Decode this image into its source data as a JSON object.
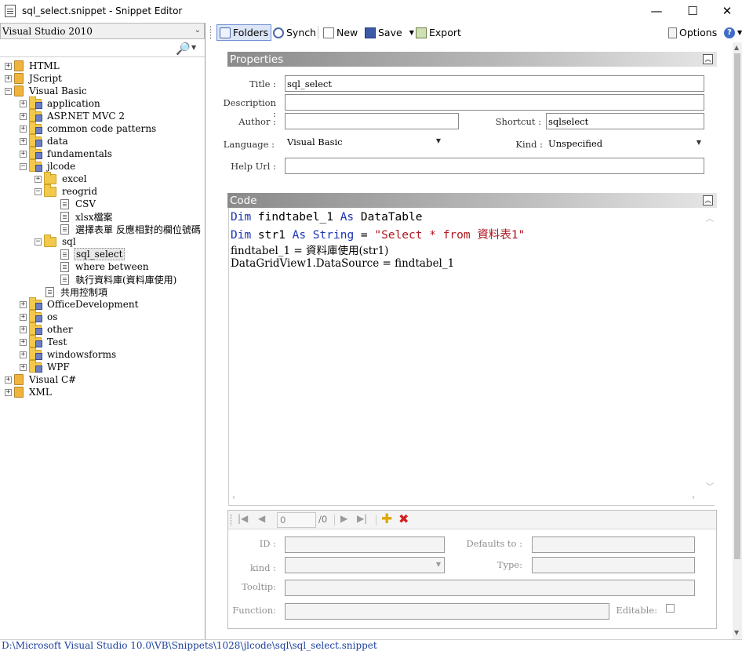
{
  "window": {
    "title": "sql_select.snippet - Snippet Editor",
    "minimize": "—",
    "maximize": "☐",
    "close": "✕"
  },
  "sidebar": {
    "language_select": "Visual Studio 2010",
    "tree": [
      {
        "label": "HTML",
        "level": 0,
        "expander": "+",
        "icon": "root-folder-icon"
      },
      {
        "label": "JScript",
        "level": 0,
        "expander": "+",
        "icon": "root-folder-icon"
      },
      {
        "label": "Visual Basic",
        "level": 0,
        "expander": "−",
        "icon": "root-folder-icon"
      },
      {
        "label": "application",
        "level": 1,
        "expander": "+",
        "icon": "category-folder-icon"
      },
      {
        "label": "ASP.NET MVC 2",
        "level": 1,
        "expander": "+",
        "icon": "category-folder-icon"
      },
      {
        "label": "common code patterns",
        "level": 1,
        "expander": "+",
        "icon": "category-folder-icon"
      },
      {
        "label": "data",
        "level": 1,
        "expander": "+",
        "icon": "category-folder-icon"
      },
      {
        "label": "fundamentals",
        "level": 1,
        "expander": "+",
        "icon": "category-folder-icon"
      },
      {
        "label": "jlcode",
        "level": 1,
        "expander": "−",
        "icon": "category-folder-icon"
      },
      {
        "label": "excel",
        "level": 2,
        "expander": "+",
        "icon": "folder-icon"
      },
      {
        "label": "reogrid",
        "level": 2,
        "expander": "−",
        "icon": "folder-icon"
      },
      {
        "label": "CSV",
        "level": 3,
        "expander": "",
        "icon": "snippet-file-icon"
      },
      {
        "label": "xlsx檔案",
        "level": 3,
        "expander": "",
        "icon": "snippet-file-icon"
      },
      {
        "label": "選擇表單 反應相對的欄位號碼",
        "level": 3,
        "expander": "",
        "icon": "snippet-file-icon"
      },
      {
        "label": "sql",
        "level": 2,
        "expander": "−",
        "icon": "folder-icon"
      },
      {
        "label": "sql_select",
        "level": 3,
        "expander": "",
        "icon": "snippet-file-icon",
        "selected": true
      },
      {
        "label": "where between",
        "level": 3,
        "expander": "",
        "icon": "snippet-file-icon"
      },
      {
        "label": "執行資料庫(資料庫使用)",
        "level": 3,
        "expander": "",
        "icon": "snippet-file-icon"
      },
      {
        "label": "共用控制項",
        "level": 2,
        "expander": "",
        "icon": "snippet-file-icon"
      },
      {
        "label": "OfficeDevelopment",
        "level": 1,
        "expander": "+",
        "icon": "category-folder-icon"
      },
      {
        "label": "os",
        "level": 1,
        "expander": "+",
        "icon": "category-folder-icon"
      },
      {
        "label": "other",
        "level": 1,
        "expander": "+",
        "icon": "category-folder-icon"
      },
      {
        "label": "Test",
        "level": 1,
        "expander": "+",
        "icon": "category-folder-icon"
      },
      {
        "label": "windowsforms",
        "level": 1,
        "expander": "+",
        "icon": "category-folder-icon"
      },
      {
        "label": "WPF",
        "level": 1,
        "expander": "+",
        "icon": "category-folder-icon"
      },
      {
        "label": "Visual C#",
        "level": 0,
        "expander": "+",
        "icon": "root-folder-icon"
      },
      {
        "label": "XML",
        "level": 0,
        "expander": "+",
        "icon": "root-folder-icon"
      }
    ]
  },
  "toolbar": {
    "folders": "Folders",
    "synch": "Synch",
    "new": "New",
    "save": "Save",
    "export": "Export",
    "options": "Options",
    "help": "?"
  },
  "properties": {
    "header": "Properties",
    "title_label": "Title :",
    "title_value": "sql_select",
    "description_label": "Description :",
    "description_value": "",
    "author_label": "Author :",
    "author_value": "",
    "shortcut_label": "Shortcut :",
    "shortcut_value": "sqlselect",
    "language_label": "Language :",
    "language_value": "Visual Basic",
    "kind_label": "Kind :",
    "kind_value": "Unspecified",
    "helpurl_label": "Help Url :",
    "helpurl_value": ""
  },
  "code": {
    "header": "Code",
    "line1": {
      "kw1": "Dim",
      "t1": " findtabel_1 ",
      "kw2": "As",
      "t2": " DataTable"
    },
    "line2": {
      "kw1": "Dim",
      "t1": " str1 ",
      "kw2": "As",
      "t2": " ",
      "kw3": "String",
      "t3": " = ",
      "str": "\"Select * from 資料表1\""
    },
    "line3": "findtabel_1 = 資料庫使用(str1)",
    "line4": "DataGridView1.DataSource = findtabel_1"
  },
  "declarations": {
    "position": "0",
    "count": "/0",
    "id_label": "ID :",
    "defaults_label": "Defaults to :",
    "kind_label": "kind :",
    "type_label": "Type:",
    "tooltip_label": "Tooltip:",
    "function_label": "Function:",
    "editable_label": "Editable:"
  },
  "status": {
    "path": "D:\\Microsoft Visual Studio 10.0\\VB\\Snippets\\1028\\jlcode\\sql\\sql_select.snippet"
  }
}
